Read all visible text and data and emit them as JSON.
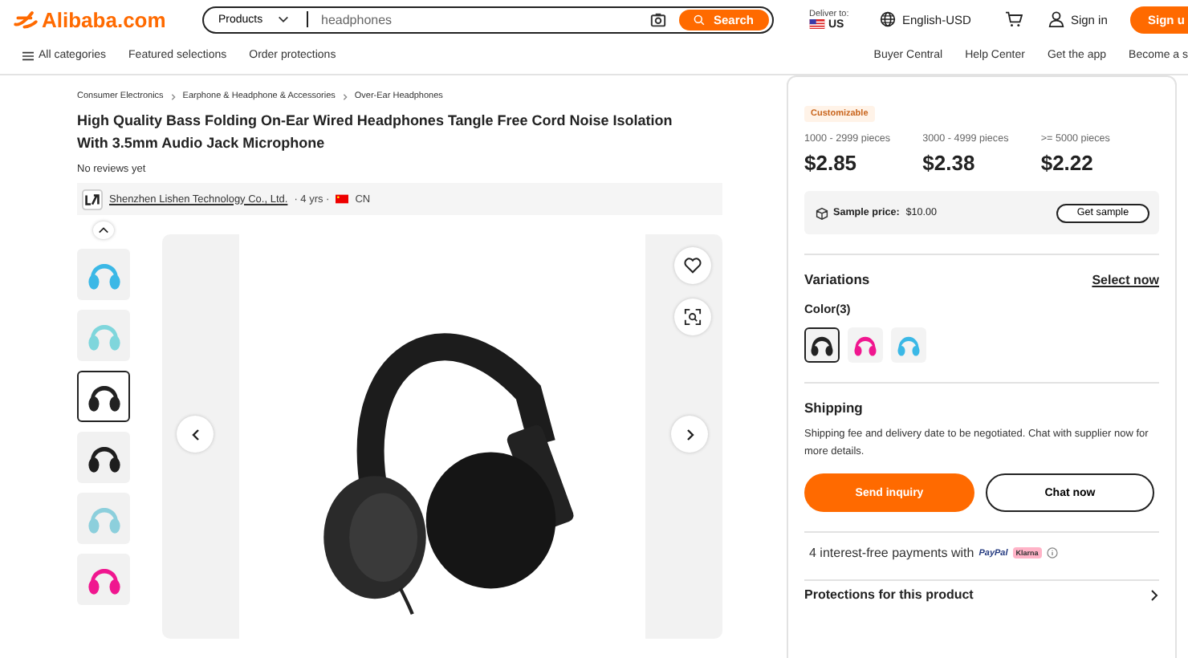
{
  "header": {
    "logo": "Alibaba.com",
    "search": {
      "scope": "Products",
      "placeholder": "headphones",
      "button": "Search"
    },
    "deliver_label": "Deliver to:",
    "deliver_country": "US",
    "language": "English-USD",
    "sign_in": "Sign in",
    "sign_up": "Sign u"
  },
  "nav": {
    "left": [
      "All categories",
      "Featured selections",
      "Order protections"
    ],
    "right": [
      "Buyer Central",
      "Help Center",
      "Get the app",
      "Become a s"
    ]
  },
  "breadcrumb": [
    "Consumer Electronics",
    "Earphone & Headphone & Accessories",
    "Over-Ear Headphones"
  ],
  "product": {
    "title": "High Quality Bass Folding On-Ear Wired Headphones Tangle Free Cord Noise Isolation With 3.5mm Audio Jack Microphone",
    "reviews": "No reviews yet",
    "supplier": "Shenzhen Lishen Technology Co., Ltd.",
    "years": "· 4 yrs ·",
    "country": "CN"
  },
  "thumbnails": [
    {
      "color": "#3bb8e6",
      "selected": false
    },
    {
      "color": "#7fd6dc",
      "selected": false
    },
    {
      "color": "#222222",
      "selected": true
    },
    {
      "color": "#1e1e1e",
      "selected": false
    },
    {
      "color": "#8ccfdc",
      "selected": false
    },
    {
      "color": "#f0168f",
      "selected": false
    }
  ],
  "pricing": {
    "tag": "Customizable",
    "tiers": [
      {
        "range": "1000 - 2999 pieces",
        "price": "$2.85"
      },
      {
        "range": "3000 - 4999 pieces",
        "price": "$2.38"
      },
      {
        "range": ">= 5000 pieces",
        "price": "$2.22"
      }
    ],
    "sample_label": "Sample price:",
    "sample_price": "$10.00",
    "sample_button": "Get sample"
  },
  "variations": {
    "title": "Variations",
    "action": "Select now",
    "color_label": "Color(3)",
    "swatches": [
      {
        "color": "#222222",
        "selected": true
      },
      {
        "color": "#f0168f",
        "selected": false
      },
      {
        "color": "#3bb8e6",
        "selected": false
      }
    ]
  },
  "shipping": {
    "title": "Shipping",
    "text": "Shipping fee and delivery date to be negotiated. Chat with supplier now for more details.",
    "primary": "Send inquiry",
    "secondary": "Chat now"
  },
  "payments": {
    "text": "4 interest-free payments with",
    "paypal": "PayPal",
    "klarna": "Klarna"
  },
  "protections": {
    "title": "Protections for this product"
  }
}
